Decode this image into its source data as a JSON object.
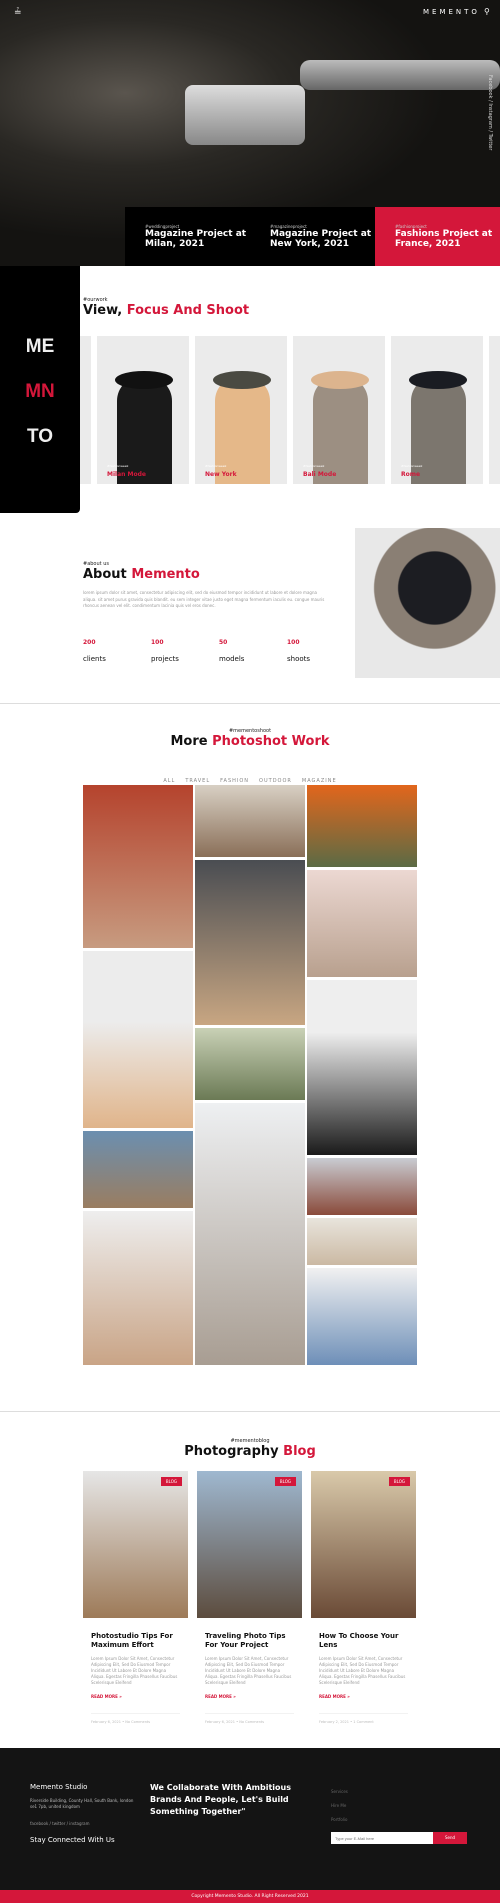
{
  "header": {
    "logo_icon": "double-chevron-icon",
    "brand": "MEMENTO",
    "search_icon": "search-icon",
    "social": "Facebook / Instagram / Twitter"
  },
  "projects": [
    {
      "tag": "#weddingproject",
      "title": "Magazine Project at Milan, 2021"
    },
    {
      "tag": "#magazineproject",
      "title": "Magazine Project at New York, 2021"
    },
    {
      "tag": "#fashionproject",
      "title": "Fashions Project at France, 2021"
    }
  ],
  "side_logo": [
    "ME",
    "MN",
    "TO"
  ],
  "work": {
    "tag": "#ourwork",
    "title_a": "View,",
    "title_b": "Focus And Shoot",
    "cards": [
      {
        "tag": "#fashionweek",
        "label": "Milan Mode"
      },
      {
        "tag": "#fashionweek",
        "label": "New York"
      },
      {
        "tag": "#fashionweek",
        "label": "Bali Mode"
      },
      {
        "tag": "#fashionweek",
        "label": "Rome"
      }
    ]
  },
  "about": {
    "tag": "#about us",
    "title_a": "About",
    "title_b": "Memento",
    "text": "lorem ipsum dolor sit amet, consectetur adipiscing elit, sed do eiusmod tempor incididunt ut labore et dolore magna aliqua. sit amet purus gravida quis blandit. eu sem integer vitae justo eget magna fermentum iaculis eu. congue mauris rhoncus aenean vel elit. condimentum lacinia quis vel eros donec.",
    "stats": [
      {
        "value": "200",
        "label": "clients"
      },
      {
        "value": "100",
        "label": "projects"
      },
      {
        "value": "50",
        "label": "models"
      },
      {
        "value": "100",
        "label": "shoots"
      }
    ]
  },
  "gallery": {
    "tag": "#mementoshoot",
    "title_a": "More",
    "title_b": "Photoshot Work",
    "filters": [
      "ALL",
      "TRAVEL",
      "FASHION",
      "OUTDOOR",
      "MAGAZINE"
    ],
    "active_filter": "ALL"
  },
  "blog": {
    "tag": "#mementoblog",
    "title_a": "Photography",
    "title_b": "Blog",
    "posts": [
      {
        "badge": "BLOG",
        "title": "Photostudio Tips For Maximum Effort",
        "excerpt": "Lorem Ipsum Dolor Sit Amet, Consectetur Adipiscing Elit, Sed Do Eiusmod Tempor Incididunt Ut Labore Et Dolore Magna Aliqua. Egestas Fringilla Phasellus Faucibus Scelerisque Eleifend",
        "more": "READ MORE »",
        "meta": "February 6, 2021  •  No Comments"
      },
      {
        "badge": "BLOG",
        "title": "Traveling Photo Tips For Your Project",
        "excerpt": "Lorem Ipsum Dolor Sit Amet, Consectetur Adipiscing Elit, Sed Do Eiusmod Tempor Incididunt Ut Labore Et Dolore Magna Aliqua. Egestas Fringilla Phasellus Faucibus Scelerisque Eleifend",
        "more": "READ MORE »",
        "meta": "February 6, 2021  •  No Comments"
      },
      {
        "badge": "BLOG",
        "title": "How To Choose Your Lens",
        "excerpt": "Lorem Ipsum Dolor Sit Amet, Consectetur Adipiscing Elit, Sed Do Eiusmod Tempor Incididunt Ut Labore Et Dolore Magna Aliqua. Egestas Fringilla Phasellus Faucibus Scelerisque Eleifend",
        "more": "READ MORE »",
        "meta": "February 2, 2021  •  1 Comment"
      }
    ]
  },
  "footer": {
    "studio": "Memento Studio",
    "address": "Riverside Building, County Hall, South Bank, london se1 7pb, united kingdom",
    "social": "facebook / twitter / instagram",
    "stay": "Stay Connected With Us",
    "quote": "We Collaborate With Ambitious Brands And People, Let's Build Something Together\"",
    "links": [
      "Services",
      "Hire Me",
      "Portfolio"
    ],
    "email_placeholder": "Type your E-Mail here",
    "send": "Send",
    "copyright": "Copyright Memento Studio. All Right Reserved 2021"
  },
  "colors": {
    "accent": "#d4173a",
    "dark": "#141414"
  }
}
